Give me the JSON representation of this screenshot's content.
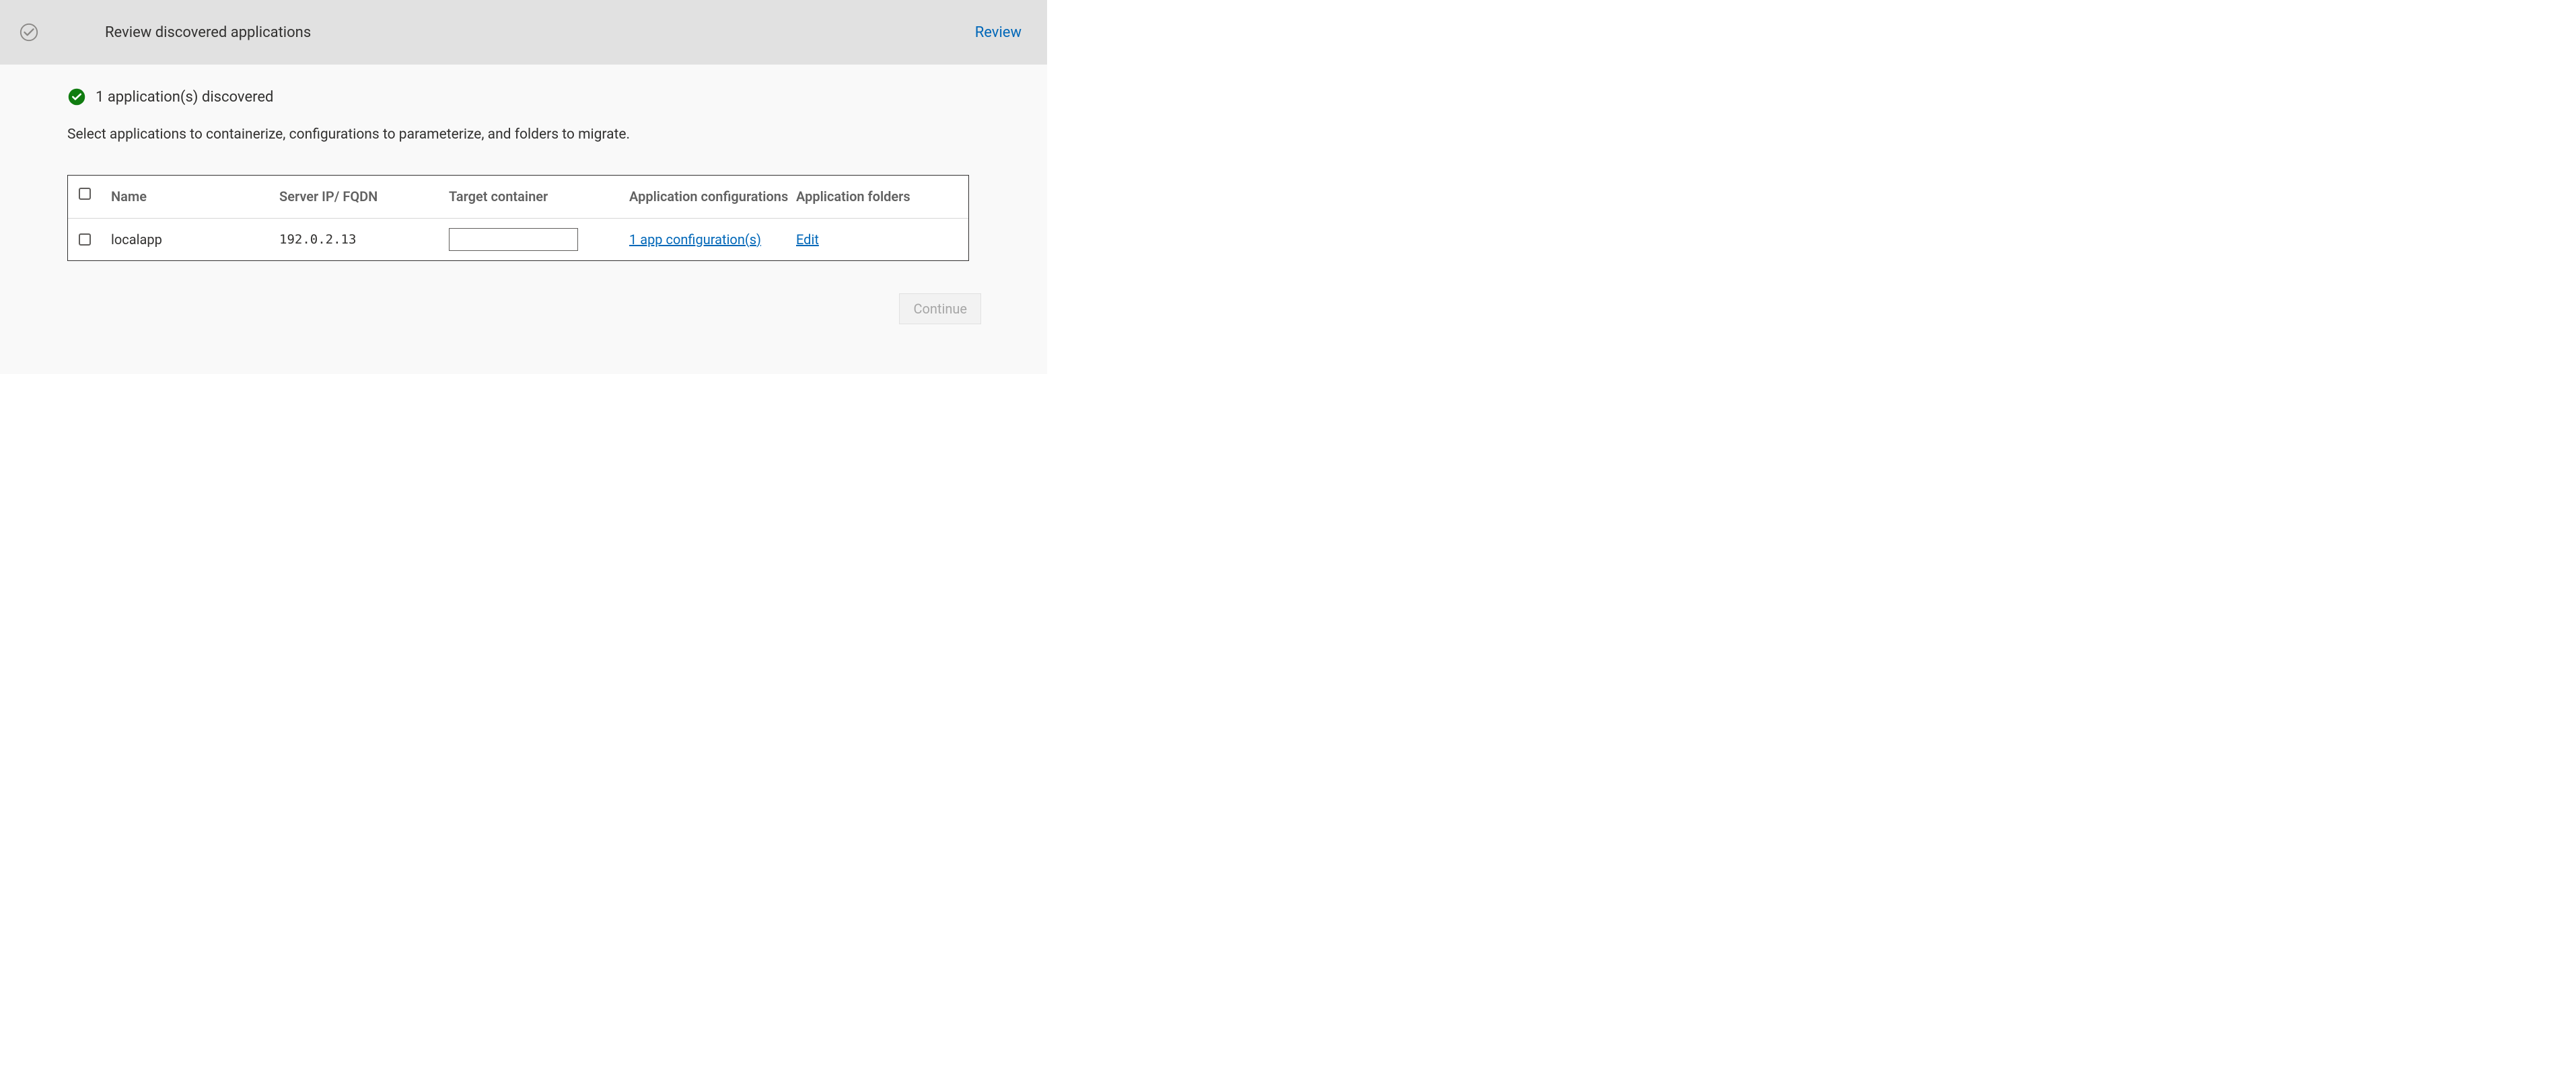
{
  "header": {
    "title": "Review discovered applications",
    "review_link": "Review"
  },
  "status": {
    "text": "1 application(s) discovered"
  },
  "instruction": "Select applications to containerize, configurations to parameterize, and folders to migrate.",
  "table": {
    "columns": {
      "name": "Name",
      "server": "Server IP/ FQDN",
      "target": "Target container",
      "config": "Application configurations",
      "folders": "Application folders"
    },
    "rows": [
      {
        "name": "localapp",
        "server": "192.0.2.13",
        "target": "",
        "config_link": "1 app configuration(s)",
        "folders_link": "Edit"
      }
    ]
  },
  "footer": {
    "continue": "Continue"
  }
}
